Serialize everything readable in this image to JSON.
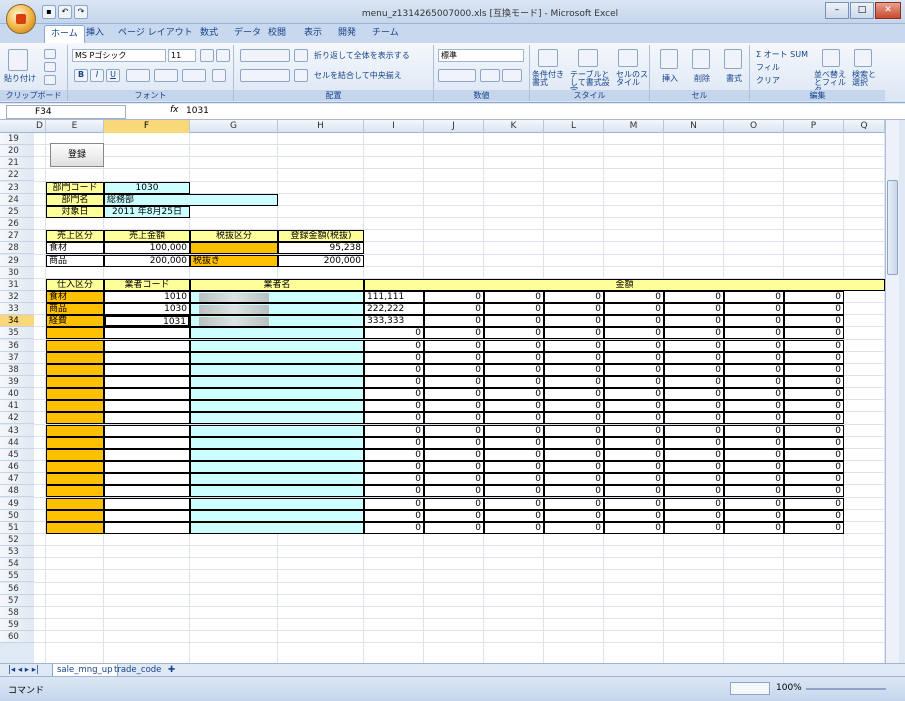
{
  "window": {
    "title": "menu_z1314265007000.xls [互換モード] - Microsoft Excel",
    "minimize": "–",
    "maximize": "□",
    "close": "✕"
  },
  "tabs": [
    "ホーム",
    "挿入",
    "ページ レイアウト",
    "数式",
    "データ",
    "校閲",
    "表示",
    "開発",
    "チーム"
  ],
  "ribbon": {
    "clipboard": {
      "paste": "貼り付け",
      "label": "クリップボード"
    },
    "font": {
      "name": "MS Pゴシック",
      "size": "11",
      "bold": "B",
      "italic": "I",
      "underline": "U",
      "label": "フォント"
    },
    "alignment": {
      "wrap": "折り返して全体を表示する",
      "merge": "セルを結合して中央揃え",
      "label": "配置"
    },
    "number": {
      "format": "標準",
      "label": "数値"
    },
    "styles": {
      "cond": "条件付き書式",
      "table": "テーブルとして書式設定",
      "cell": "セルのスタイル",
      "label": "スタイル"
    },
    "cells": {
      "insert": "挿入",
      "delete": "削除",
      "format": "書式",
      "label": "セル"
    },
    "editing": {
      "autosum": "Σ オート SUM",
      "fill": "フィル",
      "clear": "クリア",
      "sort": "並べ替えとフィルタ",
      "find": "検索と選択",
      "label": "編集"
    }
  },
  "formula": {
    "namebox": "F34",
    "fx": "fx",
    "value": "1031"
  },
  "columns": [
    "D",
    "E",
    "F",
    "G",
    "H",
    "I",
    "J",
    "K",
    "L",
    "M",
    "N",
    "O",
    "P",
    "Q"
  ],
  "rows_start": 19,
  "rows_end": 60,
  "sheet": {
    "register_button": "登録",
    "dept_code_label": "部門コード",
    "dept_code": "1030",
    "dept_name_label": "部門名",
    "dept_name": "総務部",
    "target_date_label": "対象日",
    "target_date": "2011 年8月25日",
    "sales_headers": [
      "売上区分",
      "売上金額",
      "税抜区分",
      "登録金額(税抜)"
    ],
    "sales_rows": [
      {
        "cat": "食材",
        "amount": "100,000",
        "tax": "",
        "reg": "95,238"
      },
      {
        "cat": "商品",
        "amount": "200,000",
        "tax": "税抜き",
        "reg": "200,000"
      }
    ],
    "purchase_headers": [
      "仕入区分",
      "業者コード",
      "業者名",
      "金額"
    ],
    "purchase_rows": [
      {
        "cat": "食材",
        "code": "1010",
        "amt": "111,111"
      },
      {
        "cat": "商品",
        "code": "1030",
        "amt": "222,222"
      },
      {
        "cat": "経費",
        "code": "1031",
        "amt": "333,333"
      }
    ],
    "zero": "0"
  },
  "sheet_tabs": [
    "sale_mng_up",
    "trade_code"
  ],
  "status": {
    "mode": "コマンド",
    "zoom": "100%"
  },
  "colors": {
    "yellow": "#ffff99",
    "orange": "#ffc000",
    "cyan": "#ccffff",
    "teal_light": "#ccfffe",
    "selected_header": "#f8d878"
  }
}
